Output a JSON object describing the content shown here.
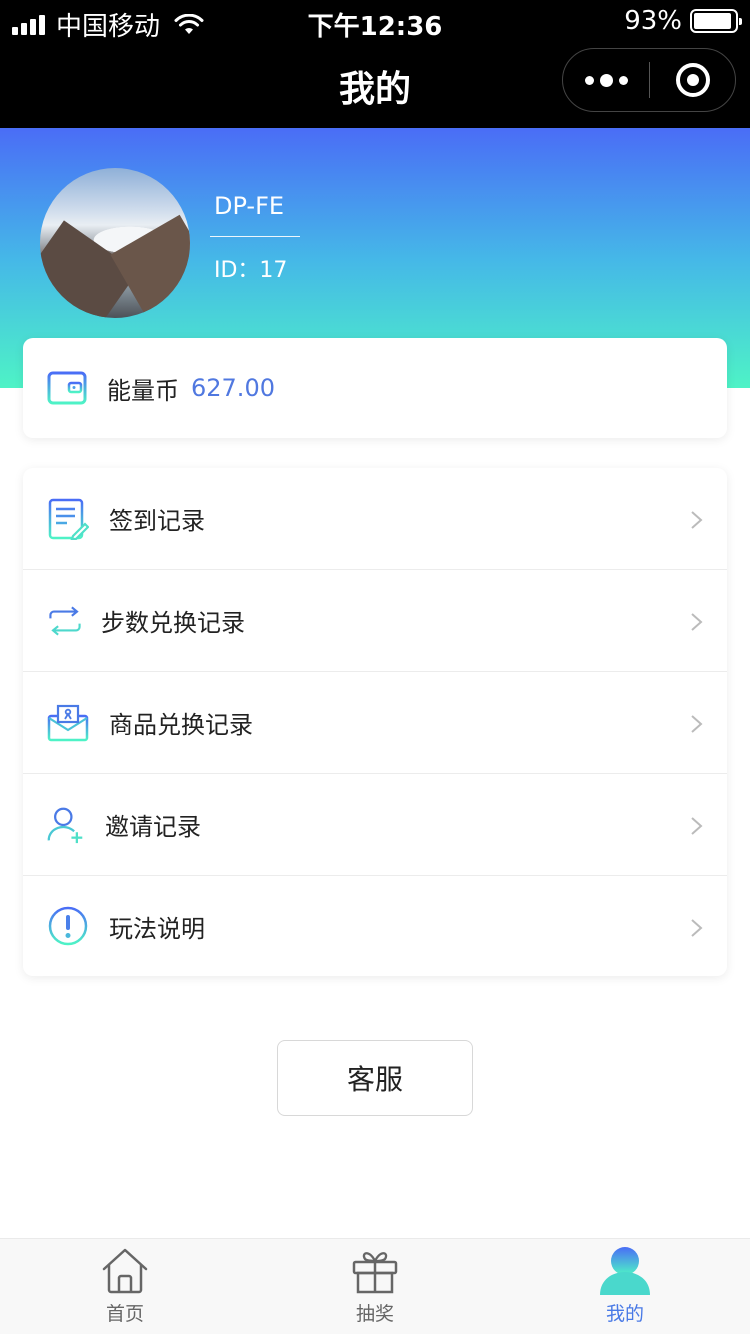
{
  "status_bar": {
    "carrier": "中国移动",
    "time": "下午12:36",
    "battery_text": "93%",
    "battery_level": 0.93
  },
  "nav": {
    "title": "我的"
  },
  "profile": {
    "name": "DP-FE",
    "id_label": "ID：17"
  },
  "coin": {
    "label": "能量币",
    "value": "627.00",
    "icon": "wallet-icon"
  },
  "menu": [
    {
      "label": "签到记录",
      "icon": "sign-in-record-icon"
    },
    {
      "label": "步数兑换记录",
      "icon": "exchange-arrows-icon"
    },
    {
      "label": "商品兑换记录",
      "icon": "envelope-icon"
    },
    {
      "label": "邀请记录",
      "icon": "add-user-icon"
    },
    {
      "label": "玩法说明",
      "icon": "info-icon"
    }
  ],
  "service_button": "客服",
  "tabs": [
    {
      "label": "首页",
      "icon": "home-icon",
      "active": false
    },
    {
      "label": "抽奖",
      "icon": "gift-icon",
      "active": false
    },
    {
      "label": "我的",
      "icon": "user-icon",
      "active": true
    }
  ],
  "colors": {
    "gradient_top": "#4a6df6",
    "gradient_bottom": "#4ef3c6",
    "accent": "#4a7ae6",
    "coin_value": "#5078e0"
  }
}
